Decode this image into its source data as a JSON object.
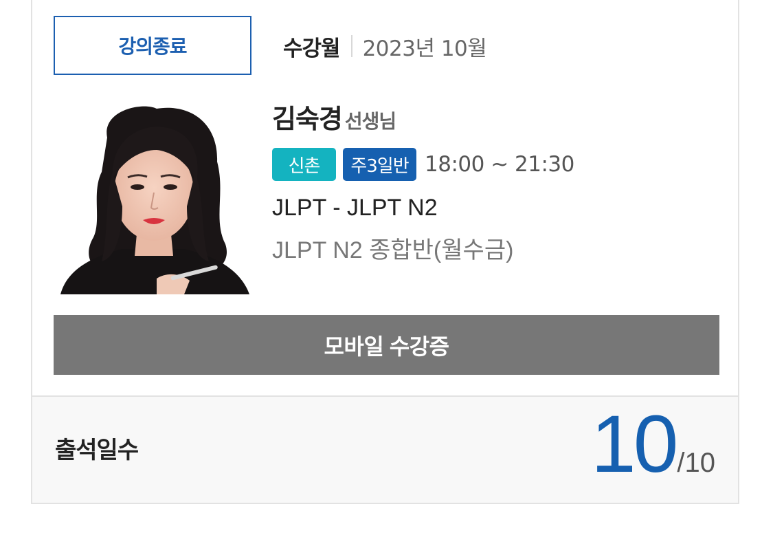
{
  "status": {
    "label": "강의종료",
    "color": "#1c5fb0"
  },
  "enrollment": {
    "label": "수강월",
    "value": "2023년 10월"
  },
  "teacher": {
    "name": "김숙경",
    "suffix": "선생님"
  },
  "tags": {
    "location": "신촌",
    "schedule": "주3일반",
    "location_color": "#14b3c0",
    "schedule_color": "#1660b0"
  },
  "time": "18:00 ~ 21:30",
  "course": {
    "category": "JLPT - JLPT N2",
    "title": "JLPT N2 종합반(월수금)"
  },
  "mobile_button": {
    "label": "모바일 수강증"
  },
  "attendance": {
    "label": "출석일수",
    "value": "10",
    "total": "/10",
    "value_color": "#1660b0"
  }
}
